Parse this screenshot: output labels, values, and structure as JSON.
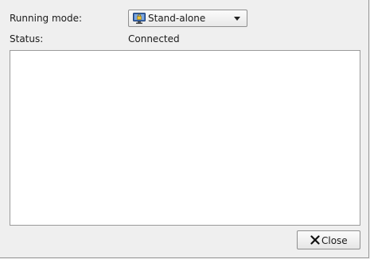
{
  "form": {
    "running_mode_label": "Running mode:",
    "running_mode_value": "Stand-alone",
    "running_mode_icon": "monitor-lock-icon",
    "status_label": "Status:",
    "status_value": "Connected"
  },
  "log": {
    "lines": []
  },
  "buttons": {
    "close_label": "Close",
    "close_icon": "close-x-icon"
  },
  "colors": {
    "background": "#efefef",
    "log_background": "#ffffff",
    "border": "#9a9a9a",
    "icon_blue": "#3f6fb5"
  }
}
